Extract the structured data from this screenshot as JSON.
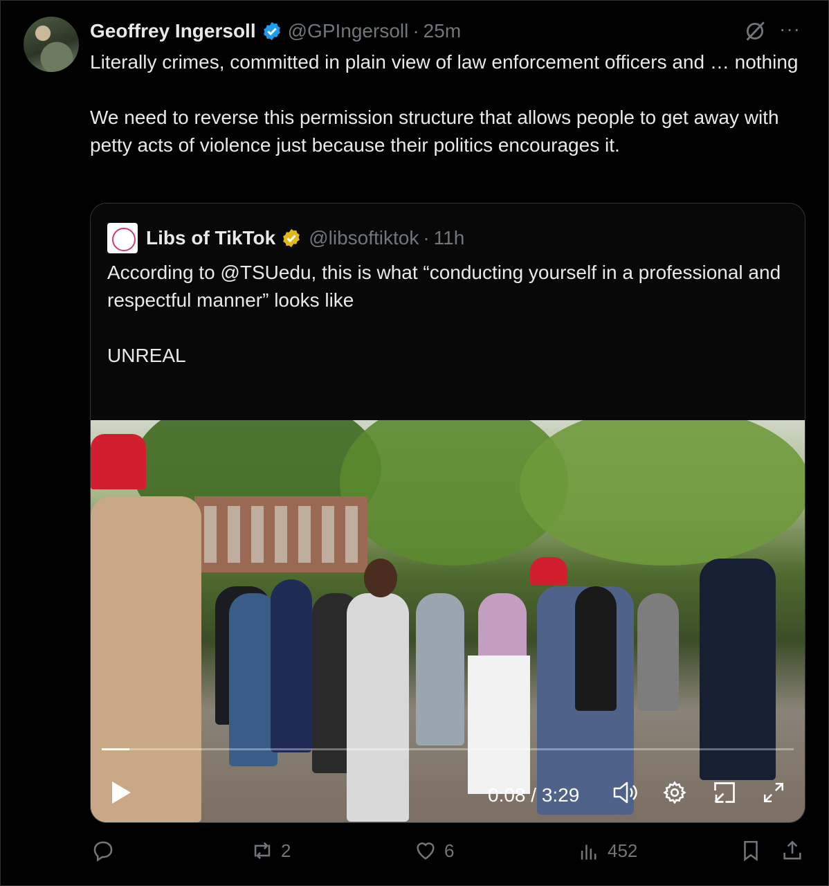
{
  "author": {
    "name": "Geoffrey Ingersoll",
    "handle": "@GPIngersoll",
    "time": "25m"
  },
  "tweet_text": "Literally crimes, committed in plain view of law enforcement officers and … nothing\n\nWe need to reverse this permission structure that allows people to get away with petty acts of violence just because their politics encourages it.",
  "quoted": {
    "name": "Libs of TikTok",
    "handle": "@libsoftiktok",
    "time": "11h",
    "text": "According to @TSUedu, this is what “conducting yourself in a professional and respectful manner” looks like\n\nUNREAL",
    "ellipsis": "..."
  },
  "video": {
    "current_time": "0:08",
    "duration": "3:29",
    "time_display": "0:08 / 3:29",
    "progress": 0.04
  },
  "actions": {
    "reply_count": "",
    "retweet_count": "2",
    "like_count": "6",
    "views_count": "452"
  },
  "colors": {
    "background": "#000000",
    "text": "#e7e9ea",
    "muted": "#71767b",
    "verified_blue": "#1d9bf0",
    "verified_gold": "#e2b719"
  }
}
